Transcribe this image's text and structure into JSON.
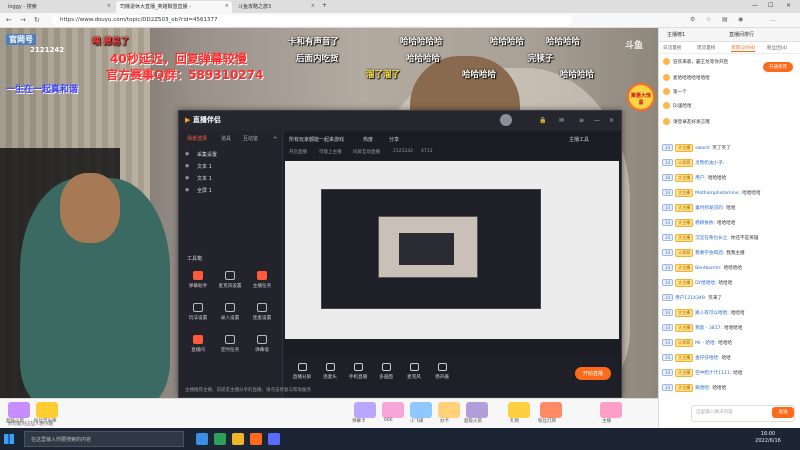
{
  "browser": {
    "tabs": [
      {
        "label": "loggy - 搜索",
        "active": false
      },
      {
        "label": "司機退休大直播_英雄聯盟直播 -",
        "active": true
      },
      {
        "label": "斗鱼攻略之旅3",
        "active": false
      }
    ],
    "url": "https://www.douyu.com/topic/DD2Z503_ob?rid=4561377"
  },
  "video": {
    "room_tag": "官网号",
    "room_number": "2121242",
    "overlay_lines": [
      {
        "text": "40秒延迟，回复弹幕较慢",
        "color": "#ff2d2d"
      },
      {
        "text": "官方赛事Q群：589310274",
        "color": "#ff2d2d"
      }
    ],
    "side_text": "一生在一起真和谐",
    "watermark": "斗鱼",
    "promo_badge": "聚惠大惊喜",
    "danmu": [
      {
        "text": "卡和有声音了",
        "color": "#ffffff"
      },
      {
        "text": "哈哈哈哈哈",
        "color": "#ffffff"
      },
      {
        "text": "哈哈哈哈",
        "color": "#ffffff"
      },
      {
        "text": "哈哈哈哈",
        "color": "#ffffff"
      },
      {
        "text": "后面内吃货",
        "color": "#ffffff"
      },
      {
        "text": "哈哈哈哈",
        "color": "#ffffff"
      },
      {
        "text": "完犊子",
        "color": "#ffffff"
      },
      {
        "text": "溜了溜了",
        "color": "#ffe24a"
      },
      {
        "text": "哈哈哈哈",
        "color": "#ffffff"
      },
      {
        "text": "哈哈哈哈",
        "color": "#ffffff"
      },
      {
        "text": "喂 愿易了",
        "color": "#ff4040"
      }
    ]
  },
  "app": {
    "logo": "直播伴侣",
    "side_tabs": [
      "场景选择",
      "道具",
      "互动室"
    ],
    "scenes": [
      "采集设置",
      "文本 1",
      "文本 1",
      "全屏 1"
    ],
    "tools_title": "工具箱",
    "tools": [
      {
        "label": "弹幕助手",
        "hot": true
      },
      {
        "label": "麦克风设置",
        "hot": false
      },
      {
        "label": "主播任务",
        "hot": true
      },
      {
        "label": "玩法设置",
        "hot": false
      },
      {
        "label": "录入设置",
        "hot": false
      },
      {
        "label": "连麦设置",
        "hot": false
      },
      {
        "label": "直播间",
        "hot": true
      },
      {
        "label": "定时任务",
        "hot": false
      },
      {
        "label": "弹幕墙",
        "hot": false
      }
    ],
    "main_tabs": [
      "所有玩家都能一起来游戏",
      "热度",
      "分享",
      "主播工具"
    ],
    "main_sub": [
      "开启直播",
      "可能上主播",
      "同屏互动直播",
      "2121242",
      "4713"
    ],
    "bottom_buttons": [
      "直播分屏",
      "连麦头",
      "手机直播",
      "多画面",
      "麦克风",
      "扬声器"
    ],
    "live_button": "开始直播",
    "status": "主播推荐主播，前提友主播分享的直播，请点击修复与帮助服务"
  },
  "giftbar": {
    "gifts": [
      "超级火箭",
      "粉丝荧光棒",
      "弹幕卡",
      "666",
      "小飞碟",
      "办卡",
      "超级火箭",
      "礼物",
      "粉丝灯牌",
      "主播"
    ],
    "bottom_info": "你可能对这些人感兴趣"
  },
  "chat": {
    "tabs": [
      "主播榜1",
      "直播间排行"
    ],
    "subtabs": [
      "日流量榜",
      "周流量榜",
      "贵宾(2694)",
      "粉丝团(4)"
    ],
    "rank_pill": "开通贵宾",
    "rank_rows": [
      "狂欢来袭，霸王龙等你开启",
      "麦哈哈哈哈哈哈哈",
      "第一个",
      "Di里哈哈",
      "请登录友好发言哦"
    ],
    "messages": [
      {
        "lvl": "14",
        "fan": "大主播",
        "user": "sword:",
        "text": "笑了笑了"
      },
      {
        "lvl": "14",
        "fan": "火哥哥",
        "user": "灵熊奶油小子:",
        "text": ""
      },
      {
        "lvl": "18",
        "fan": "大主播",
        "user": "用户:",
        "text": "哈哈哈哈"
      },
      {
        "lvl": "14",
        "fan": "大主播",
        "user": "Mathamphetamine:",
        "text": "哈哈哈哈"
      },
      {
        "lvl": "14",
        "fan": "大主播",
        "user": "童时到发问的:",
        "text": "哈哈"
      },
      {
        "lvl": "14",
        "fan": "大主播",
        "user": "杨柳依依:",
        "text": "哈哈哈哈"
      },
      {
        "lvl": "14",
        "fan": "大主播",
        "user": "沉淀在希也长之:",
        "text": "你还不是英雄"
      },
      {
        "lvl": "14",
        "fan": "火哥哥",
        "user": "我要学会喝酒:",
        "text": "我我主播"
      },
      {
        "lvl": "14",
        "fan": "大主播",
        "user": "Bentkomm:",
        "text": "哈哈哈哈"
      },
      {
        "lvl": "14",
        "fan": "大主播",
        "user": "DY哈哈哈:",
        "text": "哈哈哈"
      },
      {
        "lvl": "14",
        "fan": "",
        "user": "用户1214349:",
        "text": "笑来了"
      },
      {
        "lvl": "14",
        "fan": "大主播",
        "user": "路人有可以哈哈:",
        "text": "哈哈哈"
      },
      {
        "lvl": "14",
        "fan": "大主播",
        "user": "我就 - 3817:",
        "text": "哈哈哈哈"
      },
      {
        "lvl": "14",
        "fan": "火哥哥",
        "user": "Mr - 哈哈:",
        "text": "哈哈哈"
      },
      {
        "lvl": "14",
        "fan": "大主播",
        "user": "金仔仔哈哈:",
        "text": "哈哈"
      },
      {
        "lvl": "14",
        "fan": "大主播",
        "user": "空中奶汁汁1111:",
        "text": "哈哈"
      },
      {
        "lvl": "14",
        "fan": "大主播",
        "user": "跳哈哈:",
        "text": "哈哈哈"
      }
    ],
    "input_placeholder": "这里输入聊天内容",
    "send_label": "发送"
  },
  "taskbar": {
    "search_placeholder": "在这里输入你要搜索的内容",
    "time": "16:00",
    "date": "2022/6/16"
  }
}
